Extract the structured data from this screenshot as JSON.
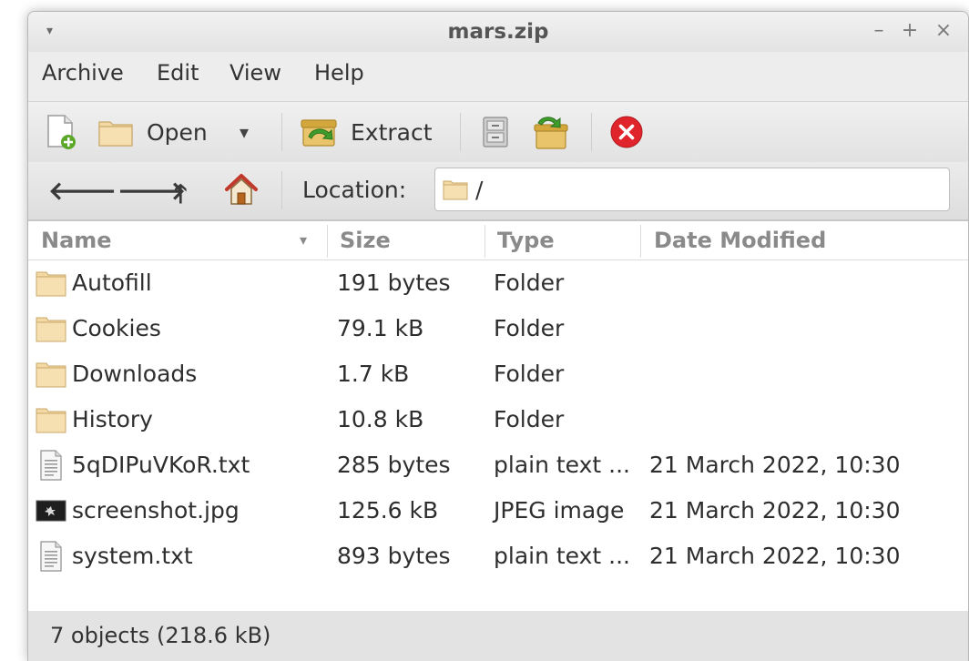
{
  "window": {
    "title": "mars.zip",
    "menu_arrow": "▾",
    "controls": {
      "minimize": "–",
      "maximize": "+",
      "close": "×"
    }
  },
  "menubar": {
    "items": [
      {
        "label": "Archive"
      },
      {
        "label": "Edit"
      },
      {
        "label": "View"
      },
      {
        "label": "Help"
      }
    ]
  },
  "toolbar": {
    "open_label": "Open",
    "open_dropdown": "▾",
    "extract_label": "Extract"
  },
  "location": {
    "back": "🡐",
    "forward": "🡒",
    "up": "🡑",
    "label": "Location:",
    "value": "/"
  },
  "file_list": {
    "columns": {
      "name": "Name",
      "size": "Size",
      "type": "Type",
      "date": "Date Modified",
      "sort_indicator": "▾"
    },
    "rows": [
      {
        "icon": "folder-icon",
        "name": "Autofill",
        "size": "191 bytes",
        "type": "Folder",
        "date": ""
      },
      {
        "icon": "folder-icon",
        "name": "Cookies",
        "size": "79.1 kB",
        "type": "Folder",
        "date": ""
      },
      {
        "icon": "folder-icon",
        "name": "Downloads",
        "size": "1.7 kB",
        "type": "Folder",
        "date": ""
      },
      {
        "icon": "folder-icon",
        "name": "History",
        "size": "10.8 kB",
        "type": "Folder",
        "date": ""
      },
      {
        "icon": "text-file-icon",
        "name": "5qDIPuVKoR.txt",
        "size": "285 bytes",
        "type": "plain text ...",
        "date": "21 March 2022, 10:30"
      },
      {
        "icon": "image-file-icon",
        "name": "screenshot.jpg",
        "size": "125.6 kB",
        "type": "JPEG image",
        "date": "21 March 2022, 10:30"
      },
      {
        "icon": "text-file-icon",
        "name": "system.txt",
        "size": "893 bytes",
        "type": "plain text ...",
        "date": "21 March 2022, 10:30"
      }
    ]
  },
  "statusbar": {
    "text": "7 objects (218.6 kB)"
  },
  "colors": {
    "folder": "#f3d9a4",
    "close_button": "#e0242b",
    "home_roof": "#c0392b"
  }
}
